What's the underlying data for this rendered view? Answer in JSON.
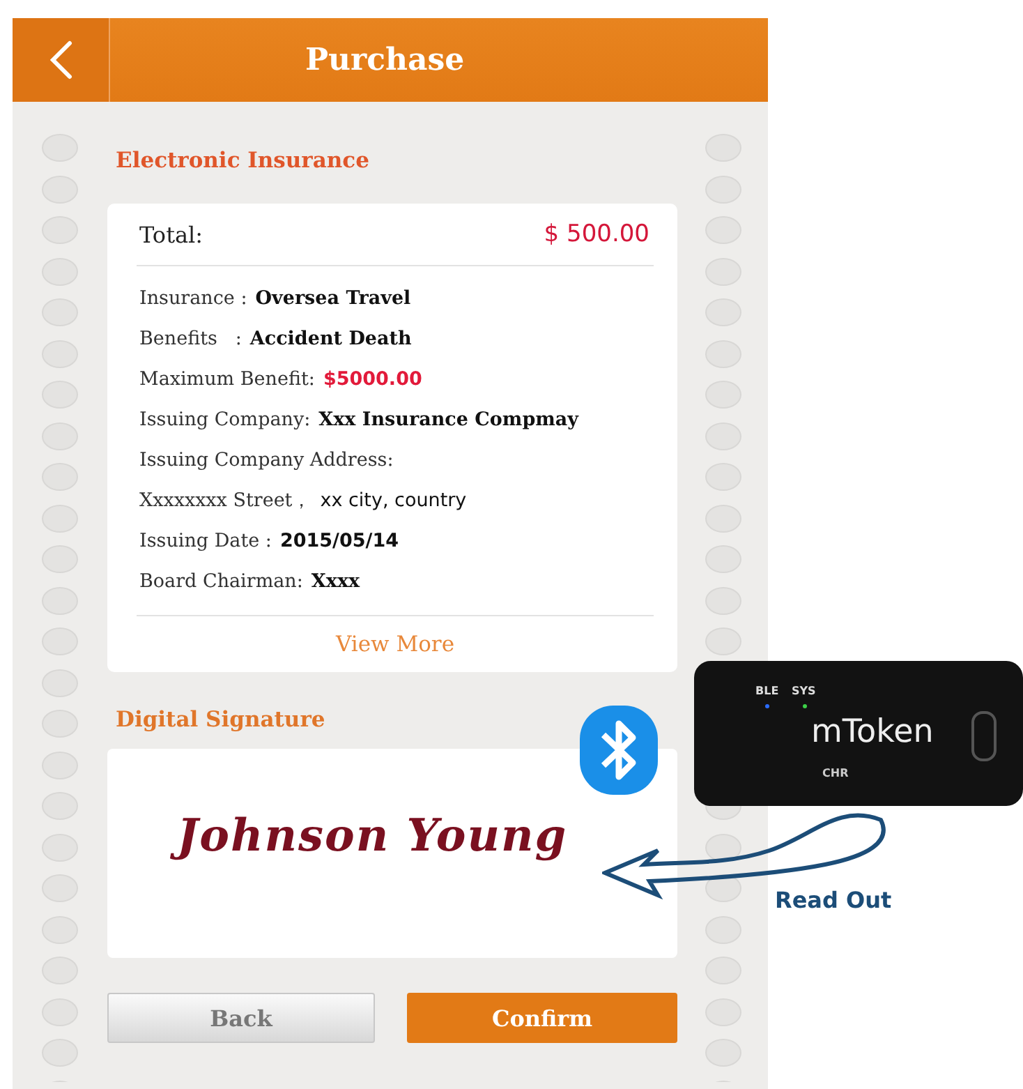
{
  "header": {
    "title": "Purchase"
  },
  "insurance_section": {
    "title": "Electronic Insurance"
  },
  "summary": {
    "total_label": "Total:",
    "total_value": "$ 500.00"
  },
  "details": [
    {
      "label": "Insurance :",
      "value": "Oversea Travel",
      "kind": "bold"
    },
    {
      "label": "Benefits   :",
      "value": "Accident Death",
      "kind": "bold"
    },
    {
      "label": "Maximum Benefit:",
      "value": "$5000.00",
      "kind": "red"
    },
    {
      "label": "Issuing Company:",
      "value": "Xxx Insurance Compmay",
      "kind": "bold"
    },
    {
      "label": "Issuing Company Address:"
    },
    {
      "label": "Xxxxxxxx Street，",
      "value": "xx city, country",
      "kind": "sans"
    },
    {
      "label": "Issuing Date :",
      "value": "2015/05/14",
      "kind": "sansbold"
    },
    {
      "label": "Board Chairman:",
      "value": "Xxxx",
      "kind": "bold"
    }
  ],
  "view_more": "View More",
  "signature_section": {
    "title": "Digital Signature",
    "signature": "Johnson Young"
  },
  "buttons": [
    {
      "label": "Back",
      "kind": "secondary"
    },
    {
      "label": "Confirm",
      "kind": "primary"
    }
  ],
  "device": {
    "led_1": "BLE",
    "led_2": "SYS",
    "brand": "mToken",
    "port": "CHR"
  },
  "arrow_label": "Read Out"
}
